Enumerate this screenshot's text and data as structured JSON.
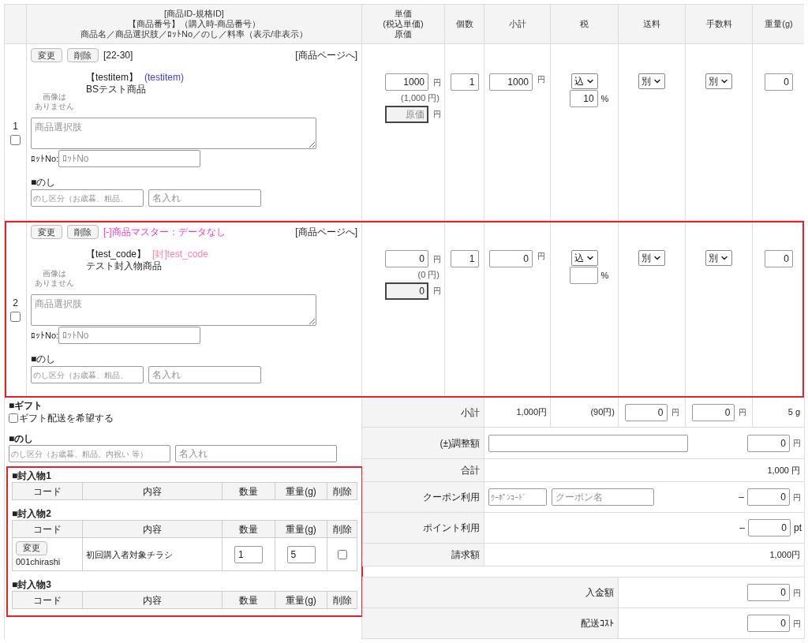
{
  "columns": [
    {
      "lines": [
        "[商品ID-規格ID]",
        "【商品番号】（購入時-商品番号）",
        "商品名／商品選択肢／ﾛｯﾄNo／のし／料率（表示/非表示）"
      ]
    },
    {
      "lines": [
        "単価",
        "(税込単価)",
        "原価"
      ]
    },
    {
      "lines": [
        "個数"
      ]
    },
    {
      "lines": [
        "小計"
      ]
    },
    {
      "lines": [
        "税"
      ]
    },
    {
      "lines": [
        "送料"
      ]
    },
    {
      "lines": [
        "手数料"
      ]
    },
    {
      "lines": [
        "重量(g)"
      ]
    }
  ],
  "items": [
    {
      "index": "1",
      "checked": false,
      "highlighted": false,
      "change_button": "変更",
      "delete_button": "削除",
      "id": "[22-30]",
      "page_link": "[商品ページへ]",
      "product_number": "【testitem】",
      "purchase_code": {
        "text": "(testitem)",
        "color": "#3b3bff"
      },
      "name": "BSテスト商品",
      "no_image": [
        "画像は",
        "ありません"
      ],
      "options_placeholder": "商品選択肢",
      "lot_label": "ﾛｯﾄNo:",
      "lot_placeholder": "ﾛｯﾄNo",
      "noshi_label": "■のし",
      "noshi_type_placeholder": "のし区分（お歳暮、粗品、",
      "noshi_name_placeholder": "名入れ",
      "price": "1000",
      "price_unit": "円",
      "price_incl": "(1,000 円)",
      "cost_placeholder": "原価",
      "cost_unit": "円",
      "quantity": "1",
      "subtotal": "1000",
      "subtotal_unit": "円",
      "tax_mode": "込",
      "tax_rate": "10",
      "rate_unit": "%",
      "shipping": "別",
      "fee": "別",
      "weight": "0"
    },
    {
      "index": "2",
      "checked": false,
      "highlighted": true,
      "change_button": "変更",
      "delete_button": "削除",
      "notice": "[-]商品マスター：データなし",
      "page_link": "[商品ページへ]",
      "product_number": "【test_code】",
      "purchase_code": {
        "text": "[封]test_code",
        "color": "#ff7fb0"
      },
      "name": "テスト封入物商品",
      "no_image": [
        "画像は",
        "ありません"
      ],
      "options_placeholder": "商品選択肢",
      "lot_label": "ﾛｯﾄNo:",
      "lot_placeholder": "ﾛｯﾄNo",
      "noshi_label": "■のし",
      "noshi_type_placeholder": "のし区分（お歳暮、粗品、",
      "noshi_name_placeholder": "名入れ",
      "price": "0",
      "price_unit": "円",
      "price_incl": "(0 円)",
      "cost": "0",
      "cost_unit": "円",
      "quantity": "1",
      "subtotal": "0",
      "subtotal_unit": "円",
      "tax_mode": "込",
      "rate_unit": "%",
      "shipping": "別",
      "fee": "別",
      "weight": "0"
    }
  ],
  "gift": {
    "title": "■ギフト",
    "checkbox_label": "ギフト配送を希望する",
    "checked": false
  },
  "noshi": {
    "title": "■のし",
    "type_placeholder": "のし区分（お歳暮、粗品、内祝い 等）",
    "name_placeholder": "名入れ"
  },
  "enclosures": {
    "highlighted": true,
    "groups": [
      {
        "title": "■封入物1",
        "columns": [
          "コード",
          "内容",
          "数量",
          "重量(g)",
          "削除"
        ]
      },
      {
        "title": "■封入物2",
        "columns": [
          "コード",
          "内容",
          "数量",
          "重量(g)",
          "削除"
        ],
        "rows": [
          {
            "change_button": "変更",
            "code": "001chirashi",
            "content": "初回購入者対象チラシ",
            "quantity": "1",
            "weight": "5",
            "checked": false
          }
        ]
      },
      {
        "title": "■封入物3",
        "columns": [
          "コード",
          "内容",
          "数量",
          "重量(g)",
          "削除"
        ]
      }
    ]
  },
  "summary": [
    {
      "kind": "subtotal",
      "label": "小計",
      "total": "1,000円",
      "tax": "(90円)",
      "shipping": "0",
      "shipping_unit": "円",
      "fee": "0",
      "fee_unit": "円",
      "weight": "5 g"
    },
    {
      "kind": "adjustment",
      "label": "(±)調整額",
      "amount": "0",
      "unit": "円"
    },
    {
      "kind": "total",
      "label": "合計",
      "amount": "1,000 円"
    },
    {
      "kind": "coupon",
      "label": "クーポン利用",
      "code_placeholder": "ｸｰﾎﾟﾝｺｰﾄﾞ",
      "name_placeholder": "クーポン名",
      "sign": "–",
      "amount": "0",
      "unit": "円"
    },
    {
      "kind": "points",
      "label": "ポイント利用",
      "sign": "–",
      "amount": "0",
      "unit": "pt"
    },
    {
      "kind": "total",
      "label": "請求額",
      "amount": "1,000円"
    },
    {
      "kind": "gap"
    },
    {
      "kind": "wide",
      "label": "入金額",
      "amount": "0",
      "unit": "円"
    },
    {
      "kind": "wide",
      "label": "配送ｺｽﾄ",
      "amount": "0",
      "unit": "円"
    }
  ]
}
